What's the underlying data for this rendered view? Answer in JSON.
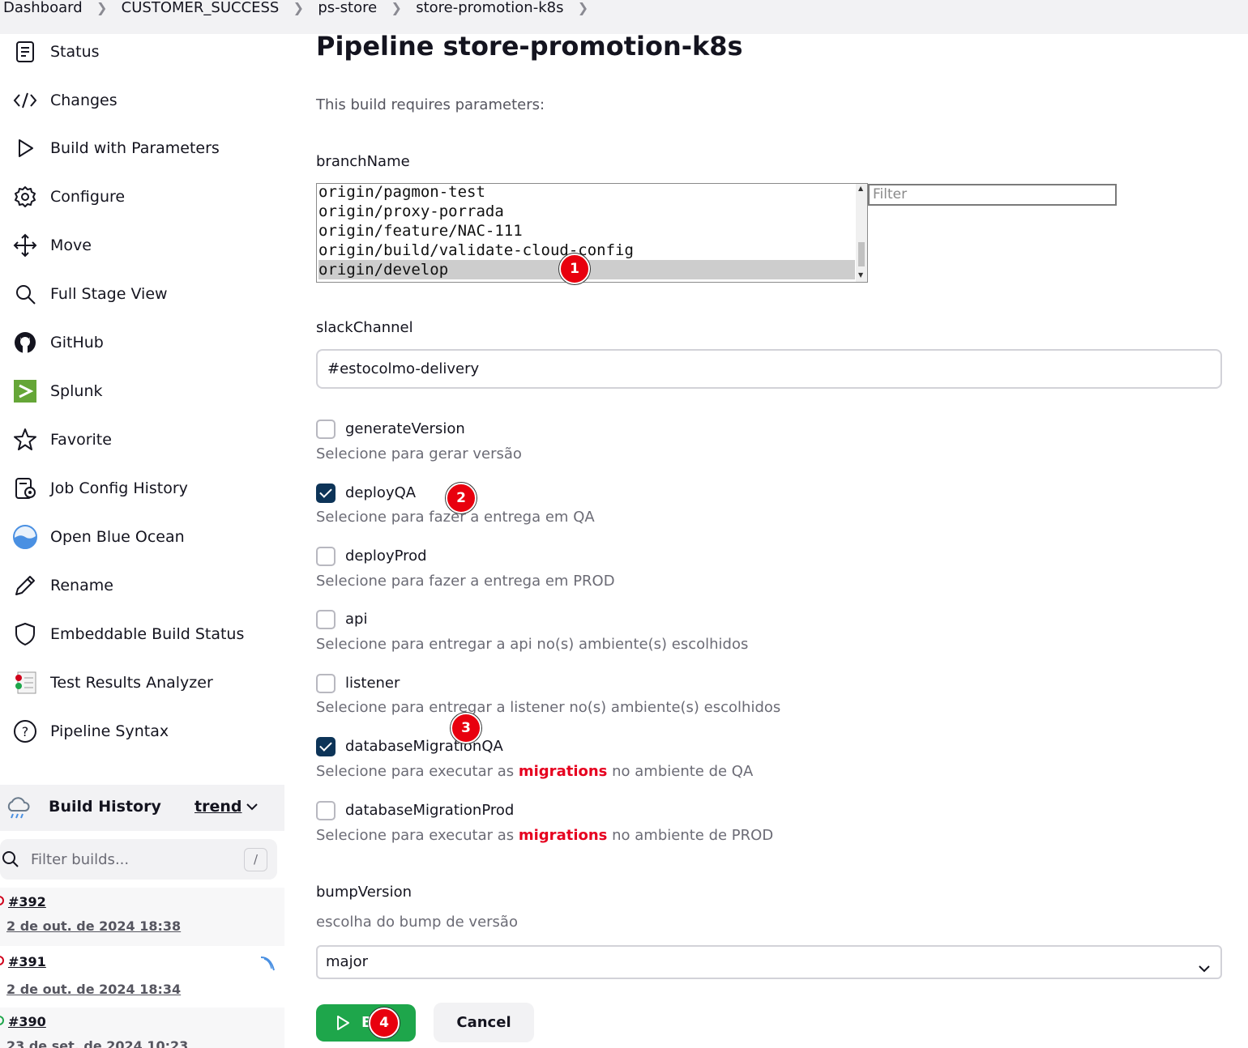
{
  "breadcrumb": [
    "Dashboard",
    "CUSTOMER_SUCCESS",
    "ps-store",
    "store-promotion-k8s"
  ],
  "sidebar": {
    "items": [
      {
        "label": "Status",
        "icon": "status-icon"
      },
      {
        "label": "Changes",
        "icon": "code-icon"
      },
      {
        "label": "Build with Parameters",
        "icon": "play-icon"
      },
      {
        "label": "Configure",
        "icon": "gear-icon"
      },
      {
        "label": "Move",
        "icon": "move-icon"
      },
      {
        "label": "Full Stage View",
        "icon": "search-icon"
      },
      {
        "label": "GitHub",
        "icon": "github-icon"
      },
      {
        "label": "Splunk",
        "icon": "splunk-icon"
      },
      {
        "label": "Favorite",
        "icon": "star-icon"
      },
      {
        "label": "Job Config History",
        "icon": "config-history-icon"
      },
      {
        "label": "Open Blue Ocean",
        "icon": "blue-ocean-icon"
      },
      {
        "label": "Rename",
        "icon": "pencil-icon"
      },
      {
        "label": "Embeddable Build Status",
        "icon": "shield-icon"
      },
      {
        "label": "Test Results Analyzer",
        "icon": "test-results-icon"
      },
      {
        "label": "Pipeline Syntax",
        "icon": "help-icon"
      }
    ]
  },
  "build_history": {
    "title": "Build History",
    "trend": "trend",
    "filter_placeholder": "Filter builds...",
    "filter_shortcut": "/",
    "builds": [
      {
        "number": "#392",
        "date": "2 de out. de 2024 18:38",
        "status_color": "#d0021b"
      },
      {
        "number": "#391",
        "date": "2 de out. de 2024 18:34",
        "status_color": "#d0021b"
      },
      {
        "number": "#390",
        "date": "23 de set. de 2024 10:23",
        "status_color": "#1ea64b"
      }
    ]
  },
  "main": {
    "title": "Pipeline store-promotion-k8s",
    "subtitle": "This build requires parameters:",
    "branch": {
      "name": "branchName",
      "options": [
        "origin/pagmon-test",
        "origin/proxy-porrada",
        "origin/feature/NAC-111",
        "origin/build/validate-cloud-config",
        "origin/develop"
      ],
      "selected_index": 4,
      "filter_placeholder": "Filter"
    },
    "slack": {
      "name": "slackChannel",
      "value": "#estocolmo-delivery"
    },
    "checkboxes": [
      {
        "name": "generateVersion",
        "checked": false,
        "desc": "Selecione para gerar versão"
      },
      {
        "name": "deployQA",
        "checked": true,
        "desc": "Selecione para fazer a entrega em QA"
      },
      {
        "name": "deployProd",
        "checked": false,
        "desc": "Selecione para fazer a entrega em PROD"
      },
      {
        "name": "api",
        "checked": false,
        "desc": "Selecione para entregar a api no(s) ambiente(s) escolhidos"
      },
      {
        "name": "listener",
        "checked": false,
        "desc": "Selecione para entregar a listener no(s) ambiente(s) escolhidos"
      },
      {
        "name": "databaseMigrationQA",
        "checked": true,
        "desc_pre": "Selecione para executar as ",
        "desc_hl": "migrations",
        "desc_post": " no ambiente de QA"
      },
      {
        "name": "databaseMigrationProd",
        "checked": false,
        "desc_pre": "Selecione para executar as ",
        "desc_hl": "migrations",
        "desc_post": " no ambiente de PROD"
      }
    ],
    "bump": {
      "name": "bumpVersion",
      "desc": "escolha do bump de versão",
      "value": "major"
    }
  },
  "footer": {
    "build_label": "B",
    "cancel_label": "Cancel"
  },
  "markers": [
    "1",
    "2",
    "3",
    "4"
  ],
  "colors": {
    "build_green": "#1ea64b",
    "checkbox_navy": "#0d3458",
    "highlight_red": "#e6001f",
    "marker_red": "#e8000e"
  }
}
